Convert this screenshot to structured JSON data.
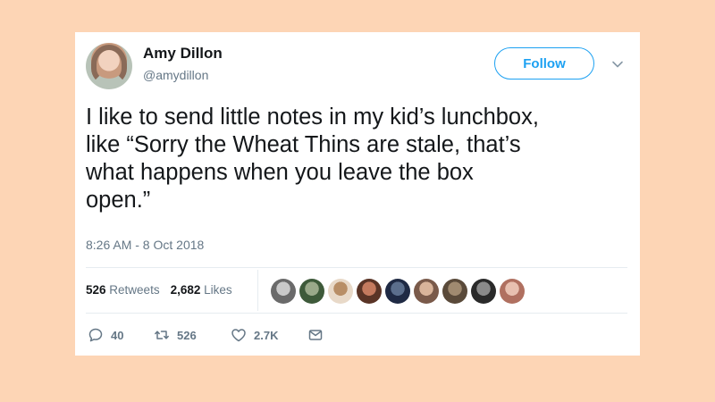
{
  "tweet": {
    "author_name": "Amy Dillon",
    "author_handle": "@amydillon",
    "follow_label": "Follow",
    "text": "I like to send little notes in my kid’s lunchbox,\nlike “Sorry the Wheat Thins are stale, that’s\nwhat happens when you leave the box\nopen.”",
    "timestamp": "8:26 AM - 8 Oct 2018",
    "retweets_count": "526",
    "retweets_label": "Retweets",
    "likes_count": "2,682",
    "likes_label": "Likes",
    "liker_avatars": [
      {
        "colors": [
          "#6a6a6a",
          "#c9c9c9"
        ]
      },
      {
        "colors": [
          "#3e5a3a",
          "#9aa98a"
        ]
      },
      {
        "colors": [
          "#e8d9c8",
          "#b88e66"
        ]
      },
      {
        "colors": [
          "#5a3426",
          "#c47a5e"
        ]
      },
      {
        "colors": [
          "#1f2a44",
          "#5b6e8c"
        ]
      },
      {
        "colors": [
          "#7a5a4a",
          "#d9b49a"
        ]
      },
      {
        "colors": [
          "#5a4a3a",
          "#a08a70"
        ]
      },
      {
        "colors": [
          "#2a2a2a",
          "#8a8a8a"
        ]
      },
      {
        "colors": [
          "#b07060",
          "#e8c0b0"
        ]
      }
    ],
    "actions": {
      "replies": "40",
      "retweets": "526",
      "likes": "2.7K"
    }
  },
  "colors": {
    "background": "#fdd5b5",
    "accent": "#1da1f2",
    "muted": "#657786",
    "text": "#14171a"
  }
}
